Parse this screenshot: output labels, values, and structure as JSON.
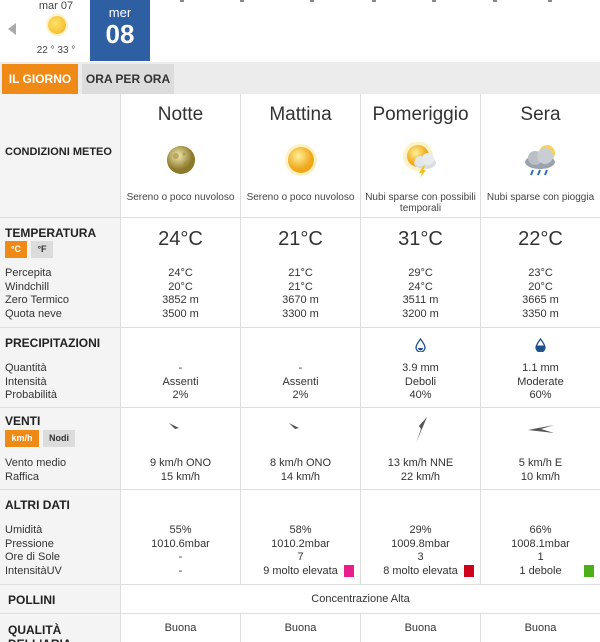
{
  "days": {
    "prev": {
      "name": "mar 07",
      "temps": "22 ° 33 °",
      "icon": "sun-icon"
    },
    "current": {
      "name": "mer",
      "number": "08"
    }
  },
  "tabs": {
    "day": "IL GIORNO",
    "hourly": "ORA PER ORA"
  },
  "conditions": {
    "label": "CONDIZIONI METEO",
    "periods": [
      {
        "name": "Notte",
        "icon": "moon-icon",
        "desc": "Sereno o poco nuvoloso"
      },
      {
        "name": "Mattina",
        "icon": "sun-icon",
        "desc": "Sereno o poco nuvoloso"
      },
      {
        "name": "Pomeriggio",
        "icon": "sun-cloud-storm-icon",
        "desc": "Nubi sparse con possibili temporali"
      },
      {
        "name": "Sera",
        "icon": "cloud-rain-icon",
        "desc": "Nubi sparse con pioggia"
      }
    ]
  },
  "temperature": {
    "label": "TEMPERATURA",
    "unit_c": "°C",
    "unit_f": "°F",
    "sublabels": [
      "Percepita",
      "Windchill",
      "Zero Termico",
      "Quota neve"
    ],
    "columns": [
      {
        "temp": "24°C",
        "vals": [
          "24°C",
          "20°C",
          "3852 m",
          "3500 m"
        ]
      },
      {
        "temp": "21°C",
        "vals": [
          "21°C",
          "21°C",
          "3670 m",
          "3300 m"
        ]
      },
      {
        "temp": "31°C",
        "vals": [
          "29°C",
          "24°C",
          "3511 m",
          "3200 m"
        ]
      },
      {
        "temp": "22°C",
        "vals": [
          "23°C",
          "20°C",
          "3665 m",
          "3350 m"
        ]
      }
    ]
  },
  "precipitation": {
    "label": "PRECIPITAZIONI",
    "sublabels": [
      "Quantità",
      "Intensità",
      "Probabilità"
    ],
    "columns": [
      {
        "drop": "",
        "vals": [
          "-",
          "Assenti",
          "2%"
        ]
      },
      {
        "drop": "",
        "vals": [
          "-",
          "Assenti",
          "2%"
        ]
      },
      {
        "drop": "drop-outline-icon",
        "vals": [
          "3.9 mm",
          "Deboli",
          "40%"
        ]
      },
      {
        "drop": "drop-filled-icon",
        "vals": [
          "1.1 mm",
          "Moderate",
          "60%"
        ]
      }
    ]
  },
  "wind": {
    "label": "VENTI",
    "unit_kmh": "km/h",
    "unit_knots": "Nodi",
    "sublabels": [
      "Vento medio",
      "Raffica"
    ],
    "columns": [
      {
        "dir_deg": 112,
        "vals": [
          "9 km/h  ONO",
          "15 km/h"
        ]
      },
      {
        "dir_deg": 112,
        "vals": [
          "8 km/h ONO",
          "14 km/h"
        ]
      },
      {
        "dir_deg": 203,
        "vals": [
          "13 km/h NNE",
          "22 km/h"
        ]
      },
      {
        "dir_deg": 270,
        "vals": [
          "5 km/h E",
          "10 km/h"
        ]
      }
    ]
  },
  "other": {
    "label": "ALTRI DATI",
    "sublabels": [
      "Umidità",
      "Pressione",
      "Ore di Sole",
      "IntensitàUV"
    ],
    "columns": [
      {
        "vals": [
          "55%",
          "1010.6mbar",
          "-",
          "-"
        ],
        "uv_color": ""
      },
      {
        "vals": [
          "58%",
          "1010.2mbar",
          "7",
          "9 molto elevata"
        ],
        "uv_color": "#e91e8c"
      },
      {
        "vals": [
          "29%",
          "1009.8mbar",
          "3",
          "8 molto elevata"
        ],
        "uv_color": "#d0021b"
      },
      {
        "vals": [
          "66%",
          "1008.1mbar",
          "1",
          "1 debole"
        ],
        "uv_color": "#4caf1a"
      }
    ]
  },
  "pollen": {
    "label": "POLLINI",
    "value": "Concentrazione Alta"
  },
  "air": {
    "label": "QUALITÀ DELL'ARIA",
    "values": [
      "Buona",
      "Buona",
      "Buona",
      "Buona"
    ]
  },
  "colors": {
    "accent": "#ef8a17",
    "day_selected": "#2e5fa3"
  }
}
